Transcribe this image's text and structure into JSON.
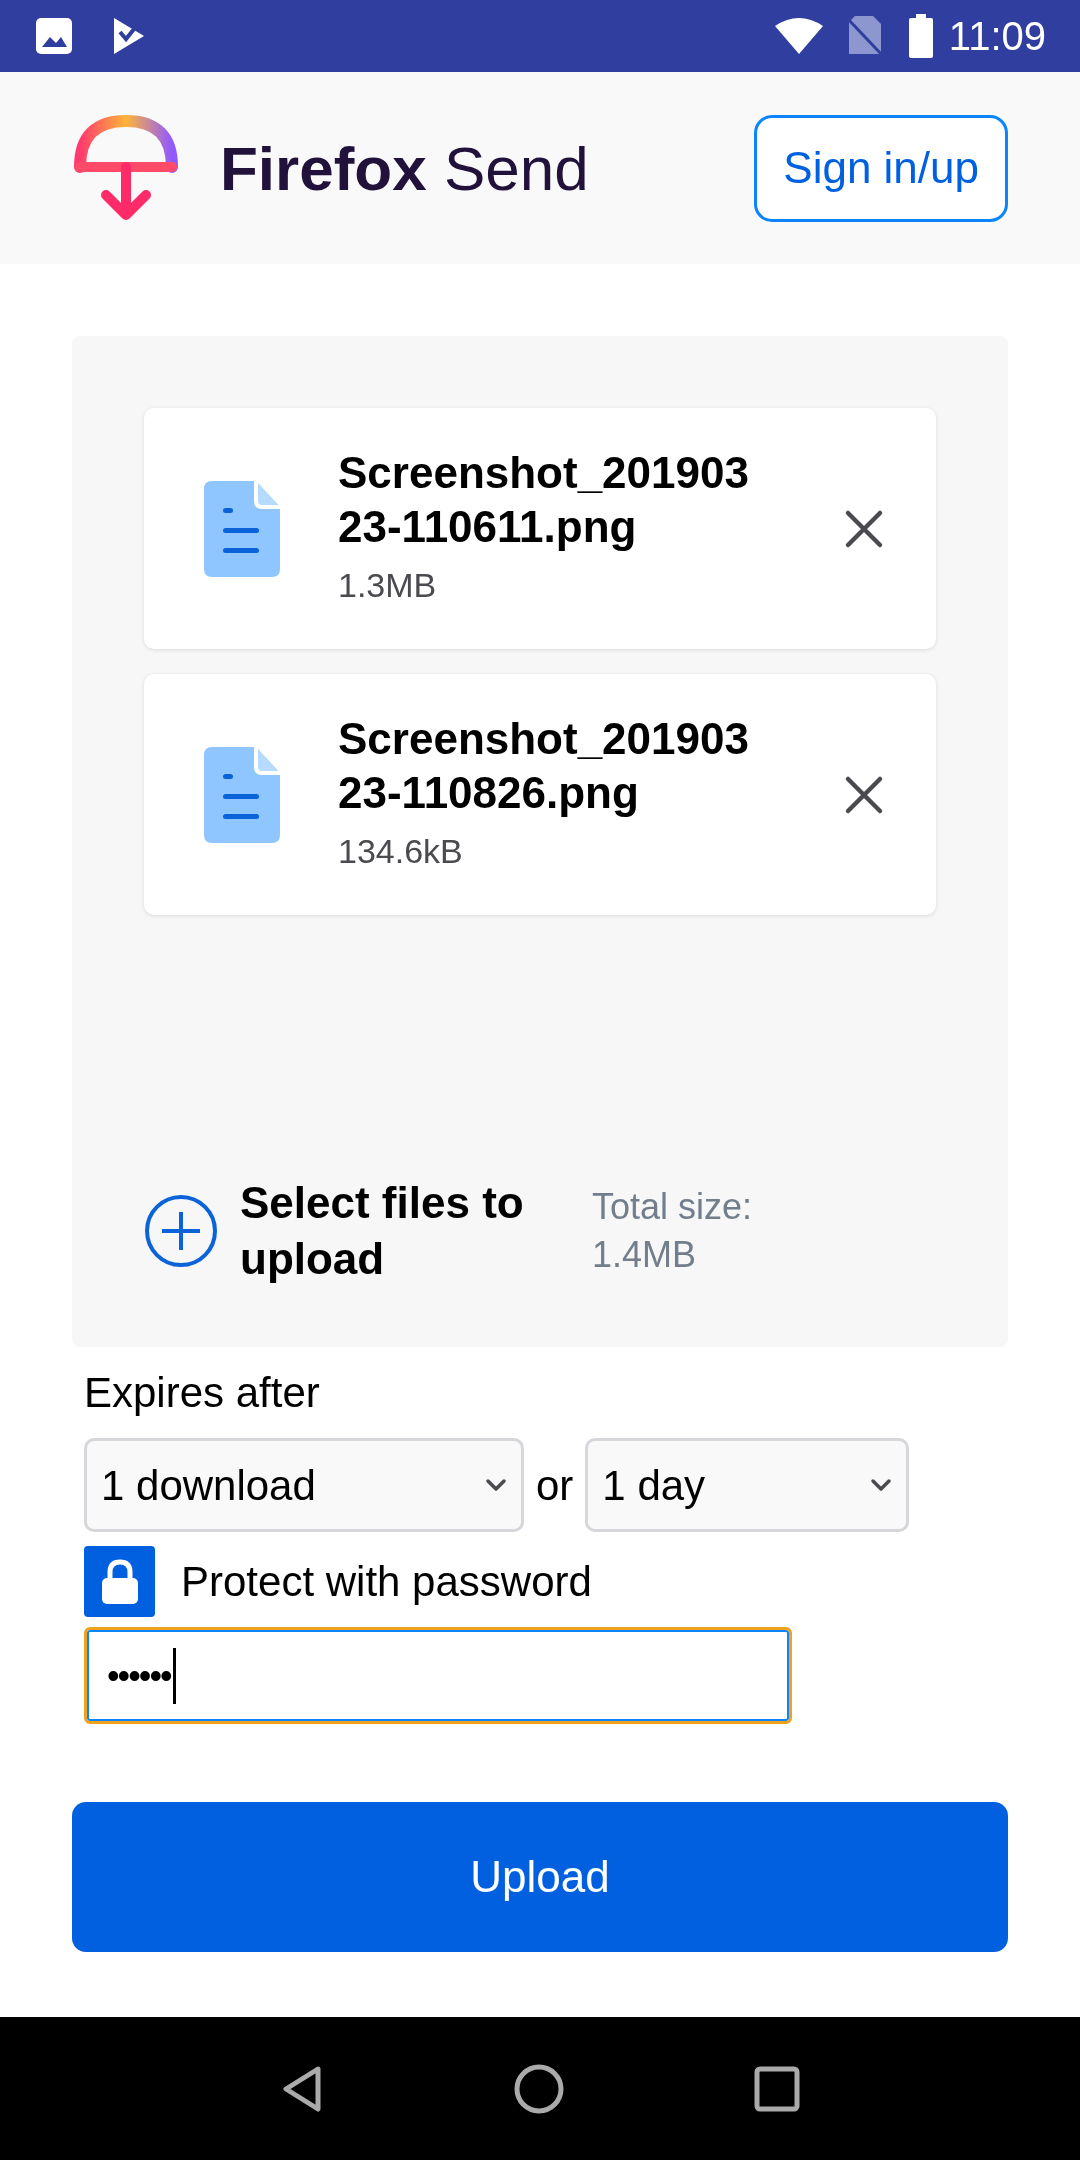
{
  "status_bar": {
    "time": "11:09"
  },
  "header": {
    "brand_bold": "Firefox",
    "brand_light": "Send",
    "sign_in": "Sign in/up"
  },
  "files": [
    {
      "name": "Screenshot_20190323-110611.png",
      "size": "1.3MB"
    },
    {
      "name": "Screenshot_20190323-110826.png",
      "size": "134.6kB"
    }
  ],
  "select_files": "Select files to upload",
  "total_size": {
    "label": "Total size:",
    "value": "1.4MB"
  },
  "expires": {
    "label": "Expires after",
    "downloads": "1 download",
    "joiner": "or",
    "time": "1 day"
  },
  "password": {
    "label": "Protect with password",
    "checked": true,
    "value": "••••••",
    "focused": true
  },
  "upload_button": "Upload"
}
